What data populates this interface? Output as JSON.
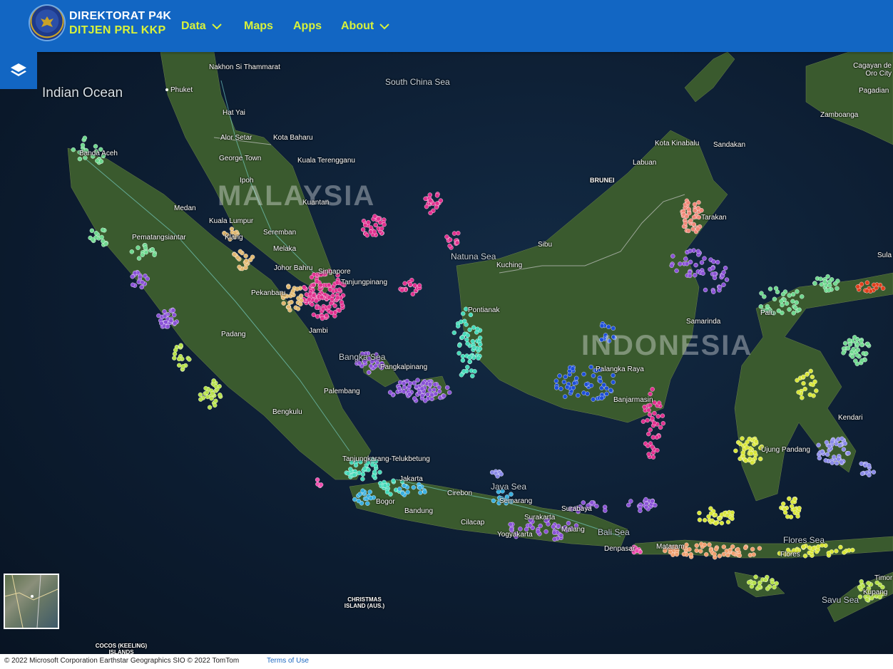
{
  "header": {
    "brand_title": "DIREKTORAT P4K",
    "brand_subtitle": "DITJEN PRL KKP",
    "nav": [
      {
        "label": "Data",
        "has_dropdown": true
      },
      {
        "label": "Maps",
        "has_dropdown": false
      },
      {
        "label": "Apps",
        "has_dropdown": false
      },
      {
        "label": "About",
        "has_dropdown": true
      }
    ],
    "colors": {
      "bar": "#1266c3",
      "accent": "#d8f23a",
      "title": "#ffffff"
    }
  },
  "map": {
    "layer_icon": "layers-icon",
    "ocean_labels": [
      "Indian Ocean"
    ],
    "sea_labels": [
      "South China Sea",
      "Natuna Sea",
      "Bangka Sea",
      "Java Sea",
      "Bali Sea",
      "Flores Sea",
      "Savu Sea"
    ],
    "country_labels": [
      "MALAYSIA",
      "INDONESIA"
    ],
    "place_labels": [
      "Nakhon Si Thammarat",
      "Phuket",
      "Hat Yai",
      "Alor Setar",
      "Kota Baharu",
      "George Town",
      "Kuala Terengganu",
      "Ipoh",
      "Kuantan",
      "Kuala Lumpur",
      "Seremban",
      "Klang",
      "Melaka",
      "Johor Bahru",
      "Singapore",
      "Tanjungpinang",
      "Pekanbaru",
      "Banda Aceh",
      "Medan",
      "Pematangsiantar",
      "Padang",
      "Jambi",
      "Pangkalpinang",
      "Palembang",
      "Bengkulu",
      "Tanjungkarang-Telukbetung",
      "Jakarta",
      "Bogor",
      "Bandung",
      "Cirebon",
      "Cilacap",
      "Semarang",
      "Yogyakarta",
      "Surakarta",
      "Surabaya",
      "Malang",
      "Denpasar",
      "Mataram",
      "Flores",
      "Kupang",
      "Timor",
      "Pontianak",
      "Kuching",
      "Sibu",
      "BRUNEI",
      "Labuan",
      "Kota Kinabalu",
      "Sandakan",
      "Tarakan",
      "Samarinda",
      "Palangka Raya",
      "Banjarmasin",
      "Palu",
      "Kendari",
      "Ujung Pandang",
      "Zamboanga",
      "Cagayan de Oro City",
      "Pagadian",
      "Sula",
      "CHRISTMAS ISLAND (AUS.)",
      "COCOS (KEELING) ISLANDS"
    ],
    "point_colors": {
      "magenta": "#e0318f",
      "purple": "#8a52d6",
      "teal": "#45d9b8",
      "green": "#6fd88f",
      "yellow": "#d8e63a",
      "lime": "#b6e04a",
      "orange": "#f0a070",
      "salmon": "#f08a7a",
      "blue": "#1e4fd8",
      "sky": "#3ab0e0",
      "lavender": "#8a8ae8",
      "tan": "#e0b870",
      "red": "#e0401e",
      "pink": "#f04fb0"
    }
  },
  "footer": {
    "attribution": "© 2022 Microsoft Corporation  Earthstar Geographics SIO  © 2022 TomTom",
    "terms": "Terms of Use"
  }
}
